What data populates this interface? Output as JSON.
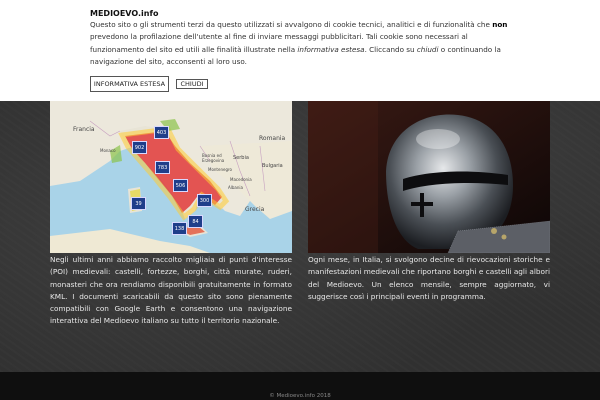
{
  "cookie": {
    "title": "MEDIOEVO.info",
    "text_1": "Questo sito o gli strumenti terzi da questo utilizzati si avvalgono di cookie tecnici, analitici e di funzionalità che ",
    "text_bold": "non",
    "text_2": " prevedono la profilazione dell'utente al fine di inviare messaggi pubblicitari. Tali cookie sono necessari al funzionamento del sito ed utili alle finalità illustrate nella ",
    "text_italic_1": "informativa estesa",
    "text_3": ". Cliccando su ",
    "text_italic_2": "chiudi",
    "text_4": " o continuando la navigazione del sito, acconsenti al loro uso.",
    "btn_info": "INFORMATIVA ESTESA",
    "btn_close": "CHIUDI"
  },
  "map": {
    "labels": {
      "france": "Francia",
      "romania": "Romania",
      "bosnia": "Bosnia ed Erzegovina",
      "serbia": "Serbia",
      "montenegro": "Montenegro",
      "macedonia": "Macedonia",
      "bulgaria": "Bulgaria",
      "albania": "Albania",
      "greece": "Grecia",
      "monaco": "Monaco"
    },
    "clusters": [
      "403",
      "902",
      "783",
      "506",
      "300",
      "39",
      "84",
      "138"
    ]
  },
  "left_text": "Negli ultimi anni abbiamo raccolto migliaia di punti d'interesse (POI) medievali: castelli, fortezze, borghi, città murate, ruderi, monasteri che ora rendiamo disponibili gratuitamente in formato KML. I documenti scaricabili da questo sito sono pienamente compatibili con Google Earth e consentono una navigazione interattiva del Medioevo italiano su tutto il territorio nazionale.",
  "right_text": "Ogni mese, in Italia, si svolgono decine di rievocazioni storiche e manifestazioni medievali che riportano borghi e castelli agli albori del Medioevo. Un elenco mensile, sempre aggiornato, vi suggerisce così i principali eventi in programma.",
  "footer": "© Medioevo.info 2018"
}
